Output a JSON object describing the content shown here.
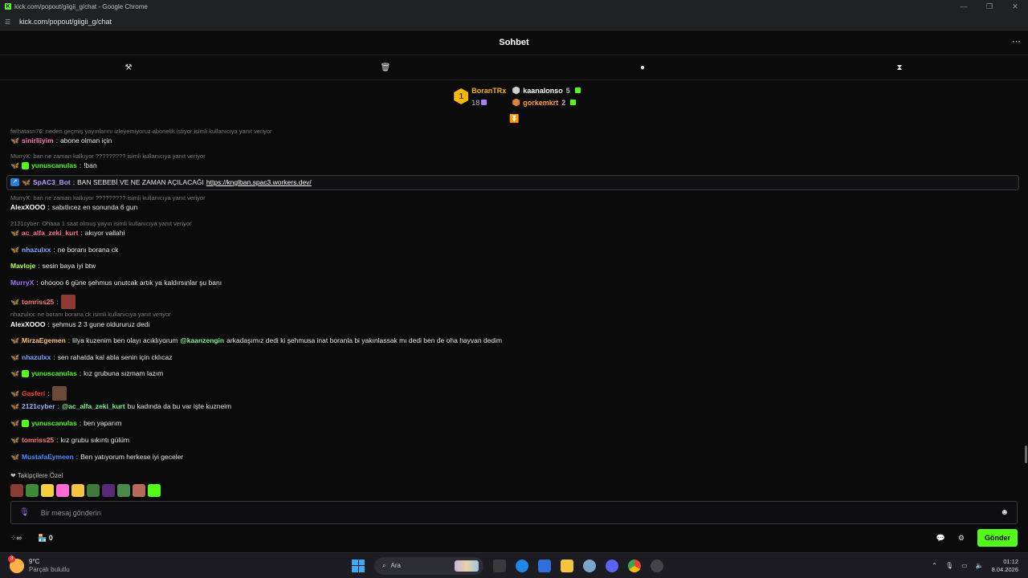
{
  "window": {
    "favicon": "K",
    "title": "kick.com/popout/giigii_g/chat - Google Chrome",
    "url": "kick.com/popout/giigii_g/chat"
  },
  "header": {
    "title": "Sohbet",
    "more": "⋯"
  },
  "mod_tools": [
    "hammer-icon",
    "trash-icon",
    "chat-bubble-icon",
    "hourglass-icon"
  ],
  "leaderboard": {
    "first": {
      "rank": "1",
      "name": "BoranTRx",
      "count": "18"
    },
    "second": {
      "name": "kaanalonso",
      "count": "5"
    },
    "third": {
      "name": "gorkemkrt",
      "count": "2"
    }
  },
  "messages": [
    {
      "type": "reply",
      "text": "ferhatasn76: neden geçmiş yayınlarını izleyemiyoruz abonelik istiyor isimli kullanıcıya yanıt veriyor"
    },
    {
      "type": "msg",
      "badges": [
        "pink"
      ],
      "user": "sinirliiyim",
      "color": "#ff7ab8",
      "text": "abone olman için"
    },
    {
      "type": "reply",
      "text": "MurryX: ban ne zaman kalkıyor ????????? isimli kullanıcıya yanıt veriyor"
    },
    {
      "type": "msg",
      "badges": [
        "pink",
        "green"
      ],
      "user": "yunuscanulas",
      "color": "#53fc18",
      "text": "!ban"
    },
    {
      "type": "msg",
      "highlight": true,
      "badges": [
        "bot",
        "pink"
      ],
      "user": "SpAC3_Bot",
      "color": "#b59cff",
      "text": "BAN SEBEBİ VE NE ZAMAN AÇILACAĞI",
      "link": "https://knglban.spac3.workers.dev/"
    },
    {
      "type": "reply",
      "text": "MurryX: ban ne zaman kalkıyor ????????? isimli kullanıcıya yanıt veriyor"
    },
    {
      "type": "msg",
      "badges": [],
      "user": "AlexXOOO",
      "color": "#ffffff",
      "text": "sabıtlıcez en sonunda 6 gun"
    },
    {
      "type": "reply",
      "text": "2121cyber: Ohaaa 1 saat olmuş yayın isimli kullanıcıya yanıt veriyor"
    },
    {
      "type": "msg",
      "badges": [
        "pink"
      ],
      "user": "ac_alfa_zeki_kurt",
      "color": "#ff6b8a",
      "text": "akıyor vallahi"
    },
    {
      "type": "msg",
      "badges": [
        "pink"
      ],
      "user": "nhazulxx",
      "color": "#7fa6ff",
      "text": "ne boranı borana ck"
    },
    {
      "type": "msg",
      "badges": [],
      "user": "Mavloje",
      "color": "#b4ff5a",
      "text": "sesin baya iyi btw"
    },
    {
      "type": "msg",
      "badges": [],
      "user": "MurryX",
      "color": "#a66bff",
      "text": "ohoooo 6 güne şehmus unutcak artık ya kaldırsınlar şu banı"
    },
    {
      "type": "msg",
      "badges": [
        "orange"
      ],
      "user": "tomriss25",
      "color": "#ff7a7a",
      "text": "",
      "emote": "#8a3b32"
    },
    {
      "type": "reply",
      "text": "nhazulxx: ne boranı borana ck isimli kullanıcıya yanıt veriyor"
    },
    {
      "type": "msg",
      "badges": [],
      "user": "AlexXOOO",
      "color": "#ffffff",
      "text": "şehmus 2 3 gune oldururuz dedı"
    },
    {
      "type": "msg",
      "badges": [
        "pink"
      ],
      "user": "MirzaEgemen",
      "color": "#ffc36b",
      "text": "lilya kuzenim ben olayı acıklıyorum",
      "mention": "@kaanzengin",
      "after": "arkadaşımız dedi ki şehmusa inat boranla bi yakınlassak mı dedi ben de oha hayvan dedim"
    },
    {
      "type": "msg",
      "badges": [
        "pink"
      ],
      "user": "nhazulxx",
      "color": "#7fa6ff",
      "text": "sen rahatda kal abla senin için cklıcaz"
    },
    {
      "type": "msg",
      "badges": [
        "pink",
        "green"
      ],
      "user": "yunuscanulas",
      "color": "#53fc18",
      "text": "kız grubuna sızmam lazım"
    },
    {
      "type": "msg",
      "badges": [
        "pink"
      ],
      "user": "Gasferi",
      "color": "#ff3b3b",
      "text": "",
      "emote": "#6b4a3a"
    },
    {
      "type": "msg",
      "badges": [
        "pink"
      ],
      "user": "2121cyber",
      "color": "#9bb4ff",
      "text": "",
      "mention": "@ac_alfa_zeki_kurt",
      "after": "bu kadında da bu var işte kuzneim"
    },
    {
      "type": "msg",
      "badges": [
        "pink",
        "green"
      ],
      "user": "yunuscanulas",
      "color": "#53fc18",
      "text": "ben yaparım"
    },
    {
      "type": "msg",
      "badges": [
        "orange"
      ],
      "user": "tomriss25",
      "color": "#ff7a7a",
      "text": "kız grubu sıkıntı gülüm"
    },
    {
      "type": "msg",
      "badges": [
        "pink"
      ],
      "user": "MustafaEymeen",
      "color": "#4d8bff",
      "text": "Ben yatıyorum herkese iyi geceler"
    }
  ],
  "followers_label": "❤ Takipçilere Özel",
  "followers_emotes": [
    "#8a3b32",
    "#3f8a3a",
    "#f4d03f",
    "#ff6ad5",
    "#f4c542",
    "#3f7a3a",
    "#5a2a7a",
    "#4a8a4a",
    "#b86a5a",
    "#53fc18"
  ],
  "input": {
    "placeholder": "Bir mesaj gönderin"
  },
  "bottom": {
    "count": "0",
    "send_label": "Gönder"
  },
  "taskbar": {
    "temp": "9°C",
    "weather": "Parçalı bulutlu",
    "weather_badge": "3",
    "search": "Ara",
    "time": "01:12",
    "date": "8.04.2026"
  }
}
